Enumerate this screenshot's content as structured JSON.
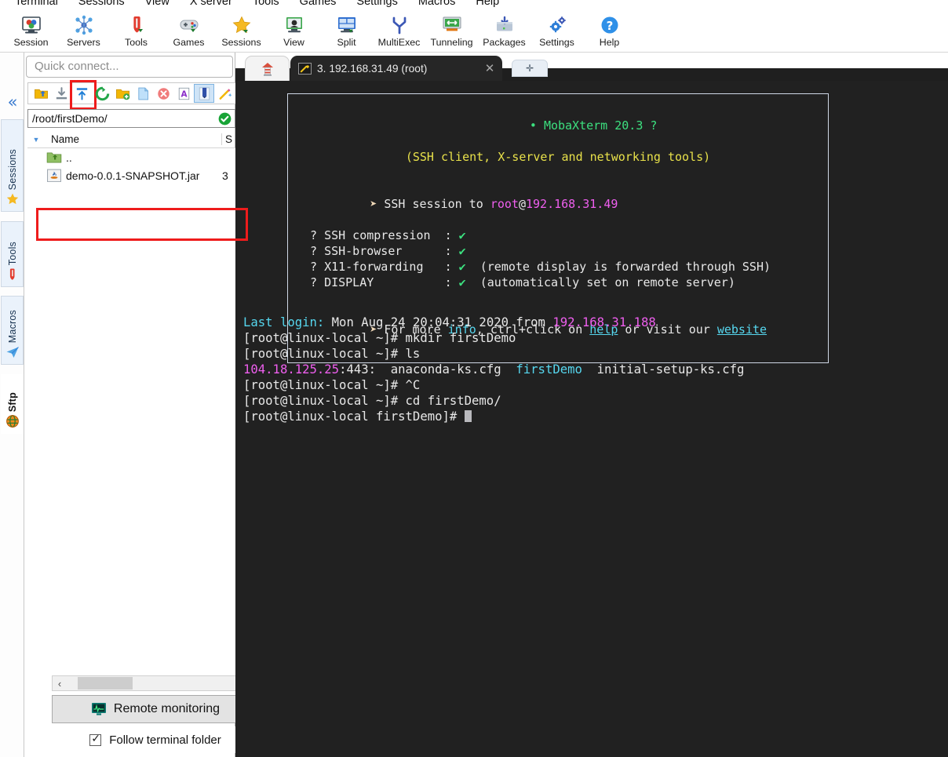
{
  "menu": {
    "items": [
      {
        "label": "Terminal"
      },
      {
        "label": "Sessions"
      },
      {
        "label": "View"
      },
      {
        "label": "X server"
      },
      {
        "label": "Tools"
      },
      {
        "label": "Games"
      },
      {
        "label": "Settings"
      },
      {
        "label": "Macros"
      },
      {
        "label": "Help"
      }
    ]
  },
  "toolbar": {
    "items": [
      {
        "label": "Session",
        "icon": "session-icon"
      },
      {
        "label": "Servers",
        "icon": "servers-icon"
      },
      {
        "label": "Tools",
        "icon": "tools-icon"
      },
      {
        "label": "Games",
        "icon": "games-icon"
      },
      {
        "label": "Sessions",
        "icon": "sessions-star-icon"
      },
      {
        "label": "View",
        "icon": "view-icon"
      },
      {
        "label": "Split",
        "icon": "split-icon"
      },
      {
        "label": "MultiExec",
        "icon": "multiexec-icon"
      },
      {
        "label": "Tunneling",
        "icon": "tunneling-icon"
      },
      {
        "label": "Packages",
        "icon": "packages-icon"
      },
      {
        "label": "Settings",
        "icon": "settings-gear-icon"
      },
      {
        "label": "Help",
        "icon": "help-icon"
      }
    ]
  },
  "dock": {
    "collapse_glyph": "«",
    "tabs": [
      {
        "label": "Sessions",
        "icon": "star-icon",
        "active": false
      },
      {
        "label": "Tools",
        "icon": "swiss-knife-icon",
        "active": false
      },
      {
        "label": "Macros",
        "icon": "paper-plane-icon",
        "active": false
      },
      {
        "label": "Sftp",
        "icon": "globe-icon",
        "active": true
      }
    ]
  },
  "sidebar": {
    "quick_connect_placeholder": "Quick connect...",
    "sftp_toolbar": [
      {
        "name": "parent-folder-icon",
        "title": "Go to parent directory"
      },
      {
        "name": "download-icon",
        "title": "Download"
      },
      {
        "name": "upload-icon",
        "title": "Upload",
        "highlighted": true
      },
      {
        "name": "refresh-icon",
        "title": "Refresh"
      },
      {
        "name": "new-folder-icon",
        "title": "New folder"
      },
      {
        "name": "new-file-icon",
        "title": "New file"
      },
      {
        "name": "delete-icon",
        "title": "Delete"
      },
      {
        "name": "text-mode-icon",
        "title": "Text mode"
      },
      {
        "name": "bookmark-icon",
        "title": "Bookmarks",
        "selected": true
      },
      {
        "name": "wand-icon",
        "title": "Advanced"
      }
    ],
    "path": "/root/firstDemo/",
    "path_status_icon": "check-circle-icon",
    "columns": {
      "name": "Name",
      "size": "S"
    },
    "files": [
      {
        "icon": "folder-up-icon",
        "name": "..",
        "size": ""
      },
      {
        "icon": "jar-file-icon",
        "name": "demo-0.0.1-SNAPSHOT.jar",
        "size": "3"
      }
    ],
    "scroll": {
      "left_glyph": "‹",
      "right_glyph": "›"
    },
    "remote_monitoring_label": "Remote monitoring",
    "remote_monitoring_icon": "monitor-chart-icon",
    "follow_terminal_label": "Follow terminal folder",
    "follow_terminal_checked": true
  },
  "tabs": {
    "home_icon": "home-lighthouse-icon",
    "session": {
      "icon": "ssh-key-icon",
      "label": "3. 192.168.31.49 (root)",
      "close_glyph": "✕"
    },
    "new_tab_glyph": "✛"
  },
  "terminal": {
    "banner": {
      "title_bullet": "•",
      "title": "MobaXterm 20.3",
      "title_suffix": "?",
      "subtitle": "(SSH client, X-server and networking tools)",
      "session_prefix": "SSH session to",
      "session_user": "root",
      "session_at": "@",
      "session_host": "192.168.31.49",
      "features": [
        {
          "q": "?",
          "label": "SSH compression",
          "colon": ":",
          "mark": "✔",
          "note": ""
        },
        {
          "q": "?",
          "label": "SSH-browser",
          "colon": ":",
          "mark": "✔",
          "note": ""
        },
        {
          "q": "?",
          "label": "X11-forwarding",
          "colon": ":",
          "mark": "✔",
          "note": "(remote display is forwarded through SSH)"
        },
        {
          "q": "?",
          "label": "DISPLAY",
          "colon": ":",
          "mark": "✔",
          "note": "(automatically set on remote server)"
        }
      ],
      "footer_pre": "For more ",
      "footer_info": "info",
      "footer_mid": ", ctrl+click on ",
      "footer_help": "help",
      "footer_or": " or visit our ",
      "footer_website": "website"
    },
    "lines": [
      {
        "segs": [
          {
            "t": "Last login:",
            "c": "c"
          },
          {
            "t": " Mon Aug 24 20:04:31 2020 from ",
            "c": "w"
          },
          {
            "t": "192.168.31.188",
            "c": "m"
          }
        ]
      },
      {
        "segs": [
          {
            "t": "[root@linux-local ~]# mkdir firstDemo",
            "c": "w"
          }
        ]
      },
      {
        "segs": [
          {
            "t": "[root@linux-local ~]# ls",
            "c": "w"
          }
        ]
      },
      {
        "segs": [
          {
            "t": "104.18.125.25",
            "c": "m"
          },
          {
            "t": ":443:  anaconda-ks.cfg  ",
            "c": "w"
          },
          {
            "t": "firstDemo",
            "c": "c"
          },
          {
            "t": "  initial-setup-ks.cfg",
            "c": "w"
          }
        ]
      },
      {
        "segs": [
          {
            "t": "[root@linux-local ~]# ^C",
            "c": "w"
          }
        ]
      },
      {
        "segs": [
          {
            "t": "[root@linux-local ~]# cd firstDemo/",
            "c": "w"
          }
        ]
      },
      {
        "segs": [
          {
            "t": "[root@linux-local firstDemo]# ",
            "c": "w"
          },
          {
            "t": "",
            "c": "cursor"
          }
        ]
      }
    ]
  },
  "colors": {
    "terminal_bg": "#212121",
    "accent_green": "#3ce07f",
    "accent_yellow": "#e8e14a",
    "accent_cyan": "#56d7ef",
    "accent_magenta": "#ef5fef",
    "highlight_red": "#ee1c1c",
    "tab_active_bg": "#262626"
  }
}
